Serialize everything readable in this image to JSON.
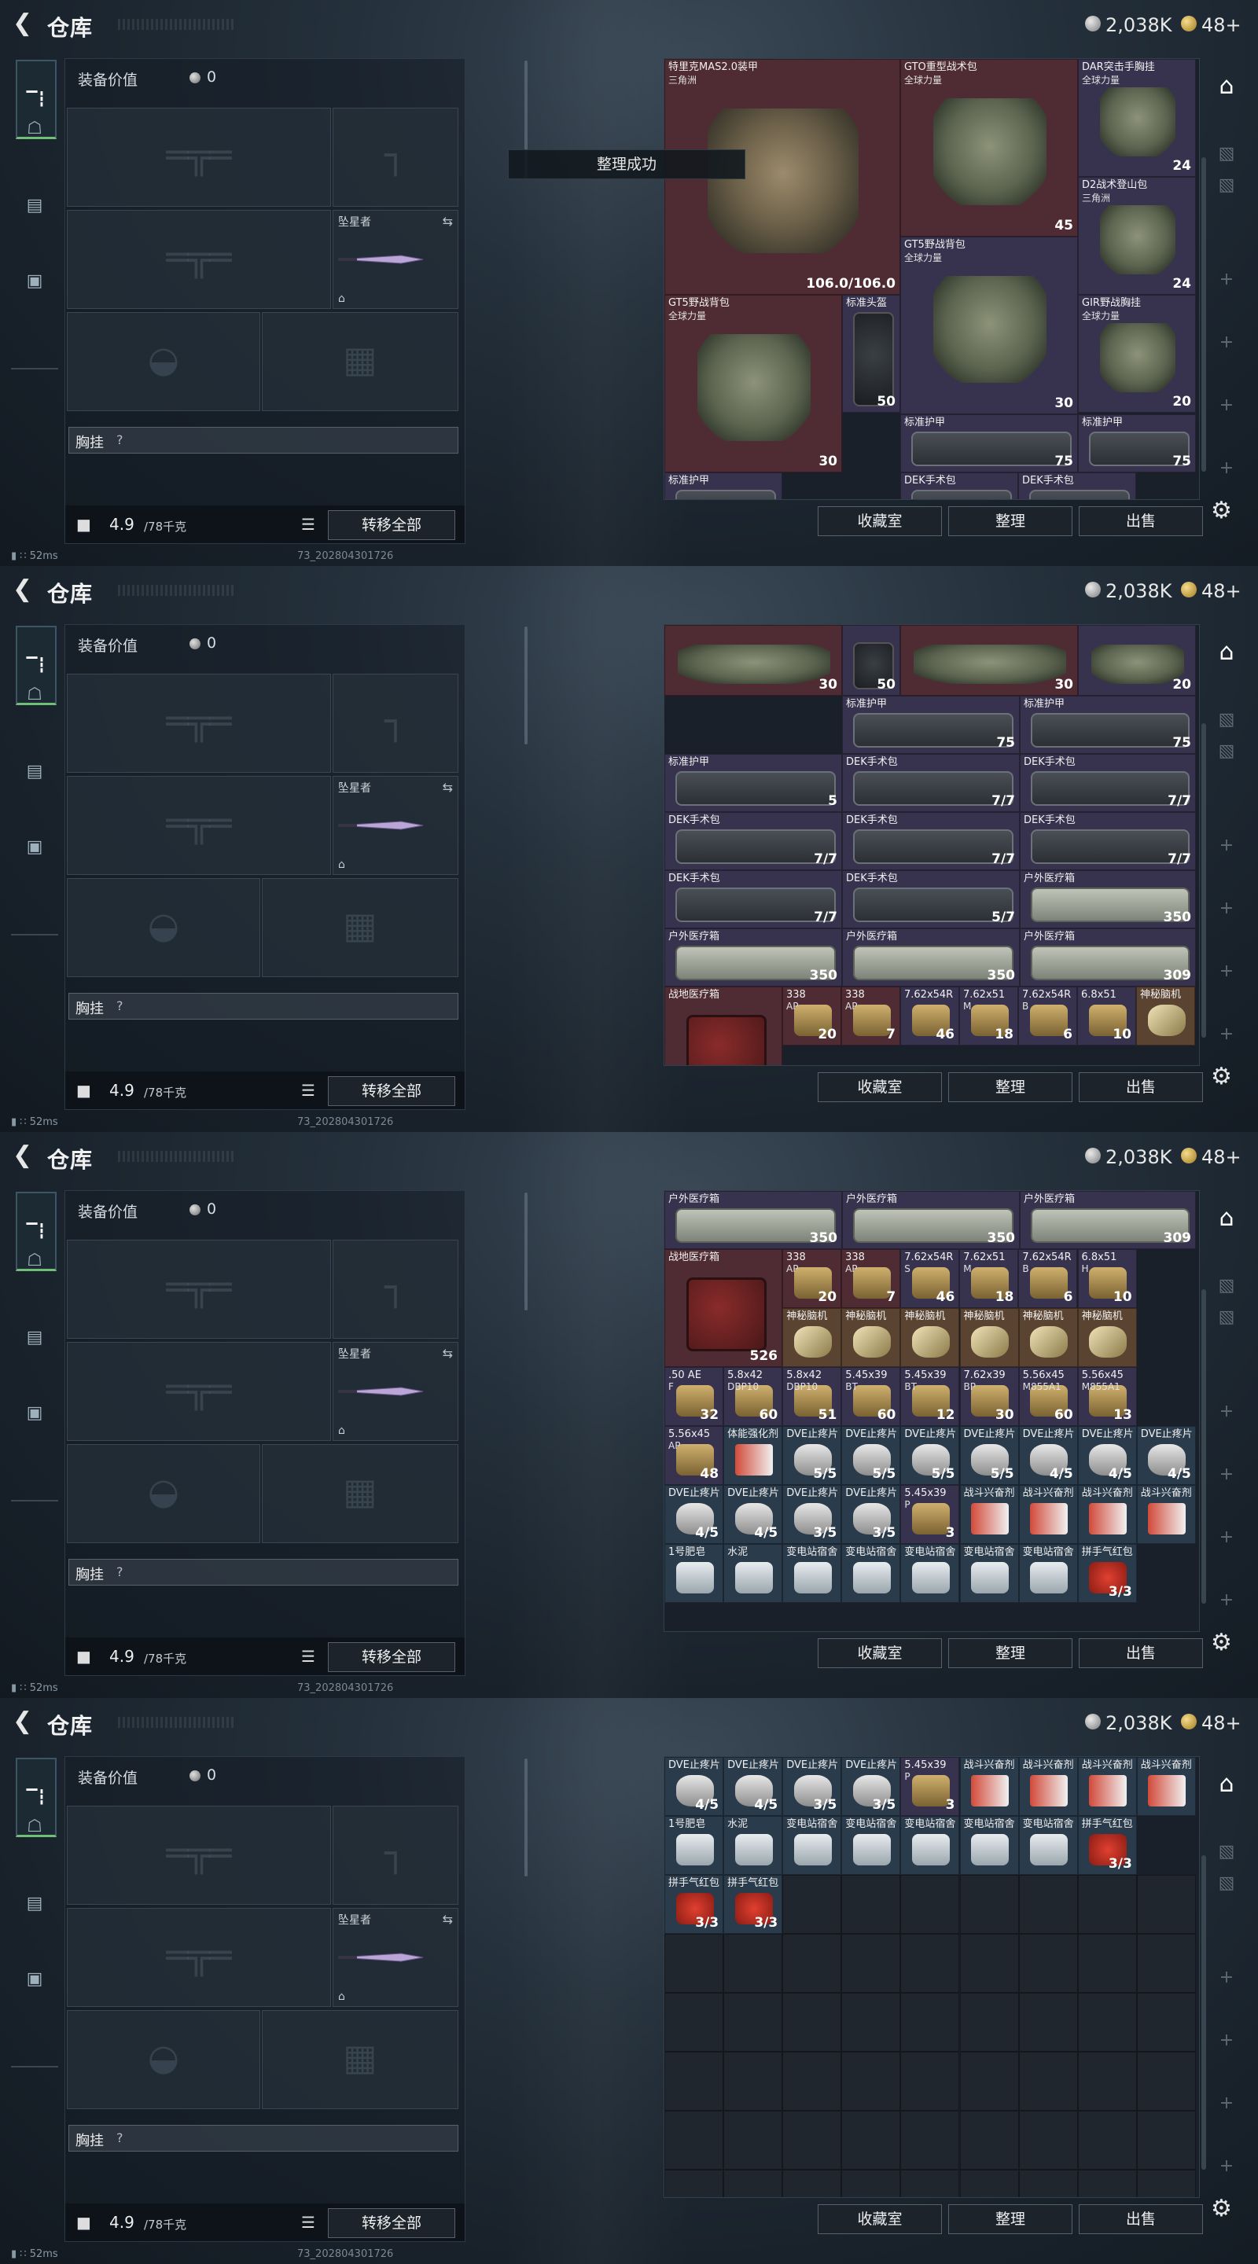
{
  "header": {
    "title": "仓库",
    "silver": "2,038K",
    "gold": "48+"
  },
  "left": {
    "equip_label": "装备价值",
    "equip_value": "0",
    "knife_label": "坠星者",
    "chest_label": "胸挂",
    "chest_q": "?",
    "weight": "4.9",
    "weight_max": "/78千克",
    "transfer_all": "转移全部"
  },
  "right_buttons": {
    "favorites": "收藏室",
    "sort": "整理",
    "sell": "出售"
  },
  "status": {
    "ping": "52ms",
    "build": "73_202804301726"
  },
  "toast": "整理成功",
  "panels": [
    {
      "toast": true,
      "items": [
        {
          "n": "特里克MAS2.0装甲",
          "s": "三角洲",
          "q": "106.0/106.0",
          "c": "c-red",
          "art": "armor"
        },
        {
          "n": "GTO重型战术包",
          "s": "全球力量",
          "q": "45",
          "c": "c-red",
          "art": "pack"
        },
        {
          "n": "DAR突击手胸挂",
          "s": "全球力量",
          "q": "24",
          "c": "c-purp",
          "art": "pack"
        },
        {
          "n": "D2战术登山包",
          "s": "三角洲",
          "q": "24",
          "c": "c-purp",
          "art": "pack"
        },
        {
          "n": "GT5野战背包",
          "s": "全球力量",
          "q": "30",
          "c": "c-purp",
          "art": "pack"
        },
        {
          "n": "GT5野战背包",
          "s": "全球力量",
          "q": "30",
          "c": "c-red",
          "art": "pack"
        },
        {
          "n": "标准头盔",
          "s": "",
          "q": "50",
          "c": "c-purp",
          "art": "helmet"
        },
        {
          "n": "GIR野战胸挂",
          "s": "全球力量",
          "q": "20",
          "c": "c-purp",
          "art": "pack"
        },
        {
          "n": "标准护甲",
          "s": "",
          "q": "75",
          "c": "c-purp",
          "art": "box"
        },
        {
          "n": "标准护甲",
          "s": "",
          "q": "75",
          "c": "c-purp",
          "art": "box"
        },
        {
          "n": "标准护甲",
          "s": "",
          "q": "",
          "c": "c-purp",
          "art": "box"
        },
        {
          "n": "DEK手术包",
          "s": "",
          "q": "",
          "c": "c-purp",
          "art": "box"
        },
        {
          "n": "DEK手术包",
          "s": "",
          "q": "",
          "c": "c-purp",
          "art": "box"
        }
      ]
    },
    {
      "toast": false,
      "items": [
        {
          "n": "",
          "s": "",
          "q": "30",
          "c": "c-red",
          "art": "pack"
        },
        {
          "n": "",
          "s": "",
          "q": "50",
          "c": "c-purp",
          "art": "helmet"
        },
        {
          "n": "",
          "s": "",
          "q": "30",
          "c": "c-red",
          "art": "pack"
        },
        {
          "n": "",
          "s": "",
          "q": "20",
          "c": "c-purp",
          "art": "pack"
        },
        {
          "n": "标准护甲",
          "s": "",
          "q": "75",
          "c": "c-purp",
          "art": "box"
        },
        {
          "n": "标准护甲",
          "s": "",
          "q": "75",
          "c": "c-purp",
          "art": "box"
        },
        {
          "n": "标准护甲",
          "s": "",
          "q": "5",
          "c": "c-purp",
          "art": "box"
        },
        {
          "n": "DEK手术包",
          "s": "",
          "q": "7/7",
          "c": "c-purp",
          "art": "box"
        },
        {
          "n": "DEK手术包",
          "s": "",
          "q": "7/7",
          "c": "c-purp",
          "art": "box"
        },
        {
          "n": "DEK手术包",
          "s": "",
          "q": "7/7",
          "c": "c-purp",
          "art": "box"
        },
        {
          "n": "DEK手术包",
          "s": "",
          "q": "7/7",
          "c": "c-purp",
          "art": "box"
        },
        {
          "n": "DEK手术包",
          "s": "",
          "q": "7/7",
          "c": "c-purp",
          "art": "box"
        },
        {
          "n": "DEK手术包",
          "s": "",
          "q": "7/7",
          "c": "c-purp",
          "art": "box"
        },
        {
          "n": "DEK手术包",
          "s": "",
          "q": "5/7",
          "c": "c-purp",
          "art": "box"
        },
        {
          "n": "户外医疗箱",
          "s": "",
          "q": "350",
          "c": "c-purp",
          "art": "med"
        },
        {
          "n": "户外医疗箱",
          "s": "",
          "q": "350",
          "c": "c-purp",
          "art": "med"
        },
        {
          "n": "户外医疗箱",
          "s": "",
          "q": "350",
          "c": "c-purp",
          "art": "med"
        },
        {
          "n": "户外医疗箱",
          "s": "",
          "q": "309",
          "c": "c-purp",
          "art": "med"
        },
        {
          "n": "战地医疗箱",
          "s": "",
          "q": "",
          "c": "c-red",
          "art": "redbag"
        },
        {
          "n": "338",
          "s": "AP",
          "q": "20",
          "c": "c-red",
          "art": "ammo"
        },
        {
          "n": "338",
          "s": "AP",
          "q": "7",
          "c": "c-red",
          "art": "ammo"
        },
        {
          "n": "7.62x54R",
          "s": "",
          "q": "46",
          "c": "c-purp",
          "art": "ammo"
        },
        {
          "n": "7.62x51",
          "s": "M",
          "q": "18",
          "c": "c-purp",
          "art": "ammo"
        },
        {
          "n": "7.62x54R",
          "s": "B",
          "q": "6",
          "c": "c-purp",
          "art": "ammo"
        },
        {
          "n": "6.8x51",
          "s": "",
          "q": "10",
          "c": "c-purp",
          "art": "ammo"
        },
        {
          "n": "神秘脑机",
          "s": "",
          "q": "",
          "c": "c-gold",
          "art": "ribbon"
        }
      ]
    },
    {
      "toast": false,
      "items": [
        {
          "n": "户外医疗箱",
          "s": "",
          "q": "350",
          "c": "c-purp",
          "art": "med"
        },
        {
          "n": "户外医疗箱",
          "s": "",
          "q": "350",
          "c": "c-purp",
          "art": "med"
        },
        {
          "n": "户外医疗箱",
          "s": "",
          "q": "309",
          "c": "c-purp",
          "art": "med"
        },
        {
          "n": "战地医疗箱",
          "s": "",
          "q": "526",
          "c": "c-red",
          "art": "redbag"
        },
        {
          "n": "338",
          "s": "AP",
          "q": "20",
          "c": "c-red",
          "art": "ammo"
        },
        {
          "n": "338",
          "s": "AP",
          "q": "7",
          "c": "c-red",
          "art": "ammo"
        },
        {
          "n": "7.62x54R",
          "s": "S",
          "q": "46",
          "c": "c-purp",
          "art": "ammo"
        },
        {
          "n": "7.62x51",
          "s": "M",
          "q": "18",
          "c": "c-purp",
          "art": "ammo"
        },
        {
          "n": "7.62x54R",
          "s": "B",
          "q": "6",
          "c": "c-purp",
          "art": "ammo"
        },
        {
          "n": "6.8x51",
          "s": "H",
          "q": "10",
          "c": "c-purp",
          "art": "ammo"
        },
        {
          "n": "神秘脑机",
          "s": "",
          "q": "",
          "c": "c-gold",
          "art": "ribbon"
        },
        {
          "n": "神秘脑机",
          "s": "",
          "q": "",
          "c": "c-gold",
          "art": "ribbon"
        },
        {
          "n": "神秘脑机",
          "s": "",
          "q": "",
          "c": "c-gold",
          "art": "ribbon"
        },
        {
          "n": "神秘脑机",
          "s": "",
          "q": "",
          "c": "c-gold",
          "art": "ribbon"
        },
        {
          "n": "神秘脑机",
          "s": "",
          "q": "",
          "c": "c-gold",
          "art": "ribbon"
        },
        {
          "n": "神秘脑机",
          "s": "",
          "q": "",
          "c": "c-gold",
          "art": "ribbon"
        },
        {
          "n": "神秘脑机",
          "s": "",
          "q": "",
          "c": "c-gold",
          "art": "ribbon"
        },
        {
          "n": "神秘脑机",
          "s": "",
          "q": "",
          "c": "c-gold",
          "art": "ribbon"
        },
        {
          "n": ".50 AE",
          "s": "F",
          "q": "32",
          "c": "c-purp",
          "art": "ammo"
        },
        {
          "n": "5.8x42",
          "s": "DBP10",
          "q": "60",
          "c": "c-purp",
          "art": "ammo"
        },
        {
          "n": "5.8x42",
          "s": "DBP10",
          "q": "51",
          "c": "c-purp",
          "art": "ammo"
        },
        {
          "n": "5.45x39",
          "s": "BT",
          "q": "60",
          "c": "c-purp",
          "art": "ammo"
        },
        {
          "n": "5.45x39",
          "s": "BT",
          "q": "12",
          "c": "c-purp",
          "art": "ammo"
        },
        {
          "n": "7.62x39",
          "s": "BP",
          "q": "30",
          "c": "c-purp",
          "art": "ammo"
        },
        {
          "n": "5.56x45",
          "s": "M855A1",
          "q": "60",
          "c": "c-purp",
          "art": "ammo"
        },
        {
          "n": "5.56x45",
          "s": "M855A1",
          "q": "13",
          "c": "c-purp",
          "art": "ammo"
        },
        {
          "n": "5.56x45",
          "s": "AP",
          "q": "48",
          "c": "c-purp",
          "art": "ammo"
        },
        {
          "n": "体能强化剂",
          "s": "",
          "q": "",
          "c": "c-blue",
          "art": "syr"
        },
        {
          "n": "DVE止疼片",
          "s": "",
          "q": "5/5",
          "c": "c-blue",
          "art": "pill"
        },
        {
          "n": "DVE止疼片",
          "s": "",
          "q": "5/5",
          "c": "c-blue",
          "art": "pill"
        },
        {
          "n": "DVE止疼片",
          "s": "",
          "q": "5/5",
          "c": "c-blue",
          "art": "pill"
        },
        {
          "n": "DVE止疼片",
          "s": "",
          "q": "5/5",
          "c": "c-blue",
          "art": "pill"
        },
        {
          "n": "DVE止疼片",
          "s": "",
          "q": "4/5",
          "c": "c-blue",
          "art": "pill"
        },
        {
          "n": "DVE止疼片",
          "s": "",
          "q": "4/5",
          "c": "c-blue",
          "art": "pill"
        },
        {
          "n": "DVE止疼片",
          "s": "",
          "q": "4/5",
          "c": "c-blue",
          "art": "pill"
        },
        {
          "n": "DVE止疼片",
          "s": "",
          "q": "4/5",
          "c": "c-blue",
          "art": "pill"
        },
        {
          "n": "DVE止疼片",
          "s": "",
          "q": "4/5",
          "c": "c-blue",
          "art": "pill"
        },
        {
          "n": "DVE止疼片",
          "s": "",
          "q": "3/5",
          "c": "c-blue",
          "art": "pill"
        },
        {
          "n": "DVE止疼片",
          "s": "",
          "q": "3/5",
          "c": "c-blue",
          "art": "pill"
        },
        {
          "n": "5.45x39",
          "s": "P",
          "q": "3",
          "c": "c-purp",
          "art": "ammo"
        },
        {
          "n": "战斗兴奋剂",
          "s": "",
          "q": "",
          "c": "c-blue",
          "art": "syr"
        },
        {
          "n": "战斗兴奋剂",
          "s": "",
          "q": "",
          "c": "c-blue",
          "art": "syr"
        },
        {
          "n": "战斗兴奋剂",
          "s": "",
          "q": "",
          "c": "c-blue",
          "art": "syr"
        },
        {
          "n": "战斗兴奋剂",
          "s": "",
          "q": "",
          "c": "c-blue",
          "art": "syr"
        },
        {
          "n": "1号肥皂",
          "s": "",
          "q": "",
          "c": "c-blue",
          "art": "pack2"
        },
        {
          "n": "水泥",
          "s": "",
          "q": "",
          "c": "c-blue",
          "art": "pack2"
        },
        {
          "n": "变电站宿舍",
          "s": "",
          "q": "",
          "c": "c-blue",
          "art": "pack2"
        },
        {
          "n": "变电站宿舍",
          "s": "",
          "q": "",
          "c": "c-blue",
          "art": "pack2"
        },
        {
          "n": "变电站宿舍",
          "s": "",
          "q": "",
          "c": "c-blue",
          "art": "pack2"
        },
        {
          "n": "变电站宿舍",
          "s": "",
          "q": "",
          "c": "c-blue",
          "art": "pack2"
        },
        {
          "n": "变电站宿舍",
          "s": "",
          "q": "",
          "c": "c-blue",
          "art": "pack2"
        },
        {
          "n": "拼手气红包",
          "s": "",
          "q": "3/3",
          "c": "c-blue",
          "art": "envelope"
        }
      ]
    },
    {
      "toast": false,
      "items": [
        {
          "n": "DVE止疼片",
          "s": "",
          "q": "4/5",
          "c": "c-blue",
          "art": "pill"
        },
        {
          "n": "DVE止疼片",
          "s": "",
          "q": "4/5",
          "c": "c-blue",
          "art": "pill"
        },
        {
          "n": "DVE止疼片",
          "s": "",
          "q": "3/5",
          "c": "c-blue",
          "art": "pill"
        },
        {
          "n": "DVE止疼片",
          "s": "",
          "q": "3/5",
          "c": "c-blue",
          "art": "pill"
        },
        {
          "n": "5.45x39",
          "s": "P",
          "q": "3",
          "c": "c-purp",
          "art": "ammo"
        },
        {
          "n": "战斗兴奋剂",
          "s": "",
          "q": "",
          "c": "c-blue",
          "art": "syr"
        },
        {
          "n": "战斗兴奋剂",
          "s": "",
          "q": "",
          "c": "c-blue",
          "art": "syr"
        },
        {
          "n": "战斗兴奋剂",
          "s": "",
          "q": "",
          "c": "c-blue",
          "art": "syr"
        },
        {
          "n": "战斗兴奋剂",
          "s": "",
          "q": "",
          "c": "c-blue",
          "art": "syr"
        },
        {
          "n": "1号肥皂",
          "s": "",
          "q": "",
          "c": "c-blue",
          "art": "pack2"
        },
        {
          "n": "水泥",
          "s": "",
          "q": "",
          "c": "c-blue",
          "art": "pack2"
        },
        {
          "n": "变电站宿舍",
          "s": "",
          "q": "",
          "c": "c-blue",
          "art": "pack2"
        },
        {
          "n": "变电站宿舍",
          "s": "",
          "q": "",
          "c": "c-blue",
          "art": "pack2"
        },
        {
          "n": "变电站宿舍",
          "s": "",
          "q": "",
          "c": "c-blue",
          "art": "pack2"
        },
        {
          "n": "变电站宿舍",
          "s": "",
          "q": "",
          "c": "c-blue",
          "art": "pack2"
        },
        {
          "n": "变电站宿舍",
          "s": "",
          "q": "",
          "c": "c-blue",
          "art": "pack2"
        },
        {
          "n": "拼手气红包",
          "s": "",
          "q": "3/3",
          "c": "c-blue",
          "art": "envelope"
        },
        {
          "n": "拼手气红包",
          "s": "",
          "q": "3/3",
          "c": "c-blue",
          "art": "envelope"
        },
        {
          "n": "拼手气红包",
          "s": "",
          "q": "3/3",
          "c": "c-blue",
          "art": "envelope"
        }
      ]
    }
  ]
}
